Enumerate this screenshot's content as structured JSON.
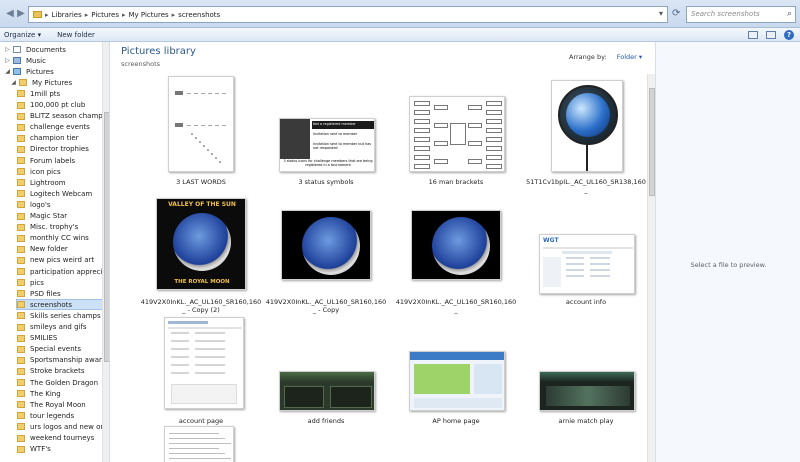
{
  "address": {
    "breadcrumbs": [
      "Libraries",
      "Pictures",
      "My Pictures",
      "screenshots"
    ],
    "search_placeholder": "Search screenshots"
  },
  "toolbar": {
    "organize": "Organize ▾",
    "new_folder": "New folder"
  },
  "sidebar": {
    "items": [
      {
        "label": "Documents",
        "type": "doc",
        "indent": 1
      },
      {
        "label": "Music",
        "type": "music",
        "indent": 1
      },
      {
        "label": "Pictures",
        "type": "pic",
        "indent": 1
      },
      {
        "label": "My Pictures",
        "type": "folder",
        "indent": 2
      },
      {
        "label": "1mill pts",
        "type": "folder",
        "indent": 3
      },
      {
        "label": "100,000 pt club",
        "type": "folder",
        "indent": 3
      },
      {
        "label": "BLITZ season champs",
        "type": "folder",
        "indent": 3
      },
      {
        "label": "challenge events",
        "type": "folder",
        "indent": 3
      },
      {
        "label": "champion tier",
        "type": "folder",
        "indent": 3
      },
      {
        "label": "Director trophies",
        "type": "folder",
        "indent": 3
      },
      {
        "label": "Forum labels",
        "type": "folder",
        "indent": 3
      },
      {
        "label": "icon pics",
        "type": "folder",
        "indent": 3
      },
      {
        "label": "Lightroom",
        "type": "folder",
        "indent": 3
      },
      {
        "label": "Logitech Webcam",
        "type": "folder",
        "indent": 3
      },
      {
        "label": "logo's",
        "type": "folder",
        "indent": 3
      },
      {
        "label": "Magic Star",
        "type": "folder",
        "indent": 3
      },
      {
        "label": "Misc. trophy's",
        "type": "folder",
        "indent": 3
      },
      {
        "label": "monthly CC wins",
        "type": "folder",
        "indent": 3
      },
      {
        "label": "New folder",
        "type": "folder",
        "indent": 3
      },
      {
        "label": "new pics weird art",
        "type": "folder",
        "indent": 3
      },
      {
        "label": "participation appreciation",
        "type": "folder",
        "indent": 3
      },
      {
        "label": "pics",
        "type": "folder",
        "indent": 3
      },
      {
        "label": "PSD files",
        "type": "folder",
        "indent": 3
      },
      {
        "label": "screenshots",
        "type": "folder",
        "indent": 3,
        "selected": true
      },
      {
        "label": "Skills series champs",
        "type": "folder",
        "indent": 3
      },
      {
        "label": "smileys and gifs",
        "type": "folder",
        "indent": 3
      },
      {
        "label": "SMILIES",
        "type": "folder",
        "indent": 3
      },
      {
        "label": "Special events",
        "type": "folder",
        "indent": 3
      },
      {
        "label": "Sportsmanship awards",
        "type": "folder",
        "indent": 3
      },
      {
        "label": "Stroke brackets",
        "type": "folder",
        "indent": 3
      },
      {
        "label": "The Golden Dragon",
        "type": "folder",
        "indent": 3
      },
      {
        "label": "The King",
        "type": "folder",
        "indent": 3
      },
      {
        "label": "The Royal Moon",
        "type": "folder",
        "indent": 3
      },
      {
        "label": "tour legends",
        "type": "folder",
        "indent": 3
      },
      {
        "label": "urs logos and new ones",
        "type": "folder",
        "indent": 3
      },
      {
        "label": "weekend tourneys",
        "type": "folder",
        "indent": 3
      },
      {
        "label": "WTF's",
        "type": "folder",
        "indent": 3
      }
    ]
  },
  "main": {
    "title": "Pictures library",
    "subtitle": "screenshots",
    "arrange_label": "Arrange by:",
    "arrange_value": "Folder ▾",
    "files": [
      {
        "caption": "3 LAST WORDS",
        "kind": "doc-lines"
      },
      {
        "caption": "3 status symbols",
        "kind": "status"
      },
      {
        "caption": "16 man brackets",
        "kind": "brackets"
      },
      {
        "caption": "51T1Cv1bpIL._AC_UL160_SR138,160\n_",
        "kind": "globe"
      },
      {
        "caption": "419V2X0InKL._AC_UL160_SR160,160\n_ - Copy (2)",
        "kind": "moon-poster"
      },
      {
        "caption": "419V2X0InKL._AC_UL160_SR160,160\n_ - Copy",
        "kind": "moon"
      },
      {
        "caption": "419V2X0InKL._AC_UL160_SR160,160\n_",
        "kind": "moon"
      },
      {
        "caption": "account info",
        "kind": "web"
      },
      {
        "caption": "account page",
        "kind": "web2"
      },
      {
        "caption": "add friends",
        "kind": "game"
      },
      {
        "caption": "AP home page",
        "kind": "home"
      },
      {
        "caption": "arnie match play",
        "kind": "game2"
      },
      {
        "caption": "",
        "kind": "doc-text"
      }
    ],
    "status_thumb": {
      "row1": "Not a registered member",
      "row2": "Invitation sent to member",
      "row3": "Invitation sent to member but has not responded",
      "footer": "3 status icons for challenge members that are being registered in a tournament"
    },
    "poster_thumb": {
      "top": "VALLEY OF THE SUN",
      "bottom": "THE ROYAL MOON"
    },
    "web_thumb": {
      "logo": "WGT"
    }
  },
  "preview": {
    "message": "Select a file to preview."
  },
  "colors": {
    "accent": "#2a5a8a",
    "folder": "#f1cd6c",
    "selection": "#cce1f6"
  }
}
